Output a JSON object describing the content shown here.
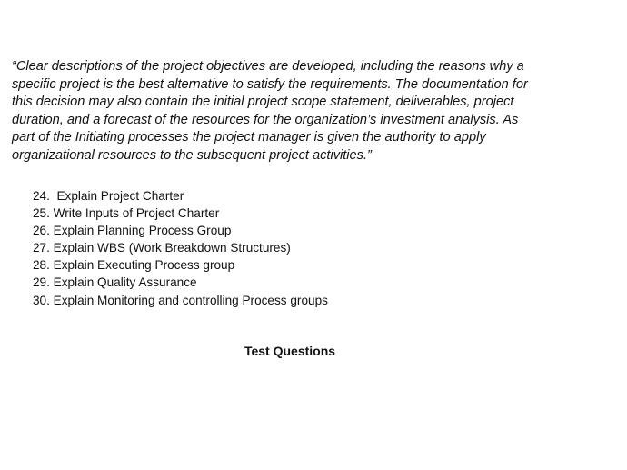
{
  "document": {
    "quote": "“Clear descriptions of the project objectives are developed, including the reasons why a\nspecific project is the best alternative to satisfy the requirements. The documentation for\nthis decision may also contain the initial project scope statement, deliverables, project\nduration, and a forecast of the resources for the organization’s investment analysis. As\npart of the Initiating processes the project manager is given the authority to apply\norganizational resources to the subsequent project activities.”",
    "questions": [
      "24.  Explain Project Charter",
      "25. Write Inputs of Project Charter",
      "26. Explain Planning Process Group",
      "27. Explain WBS (Work Breakdown Structures)",
      "28. Explain Executing Process group",
      "29. Explain Quality Assurance",
      "30. Explain Monitoring and controlling Process groups"
    ],
    "section_heading": "Test Questions"
  }
}
